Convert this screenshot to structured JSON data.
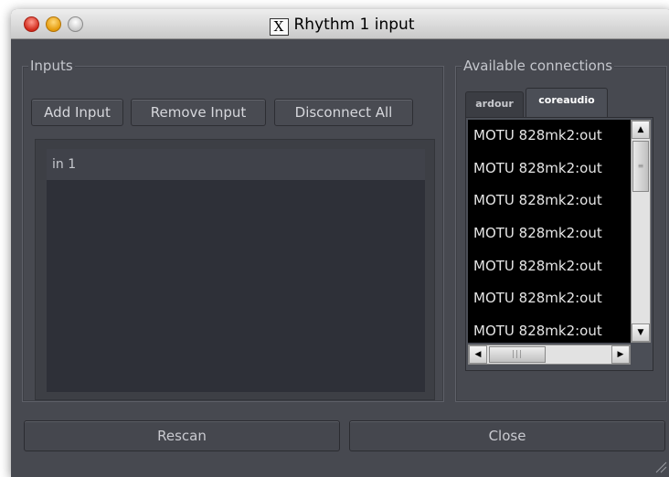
{
  "window": {
    "title": "Rhythm 1 input",
    "title_icon_glyph": "X"
  },
  "inputs": {
    "label": "Inputs",
    "buttons": {
      "add": "Add Input",
      "remove": "Remove Input",
      "disconnect": "Disconnect All"
    },
    "ports": [
      "in 1"
    ]
  },
  "connections": {
    "label": "Available connections",
    "tabs": [
      {
        "label": "ardour",
        "active": false
      },
      {
        "label": "coreaudio",
        "active": true
      }
    ],
    "items": [
      "MOTU 828mk2:out",
      "MOTU 828mk2:out",
      "MOTU 828mk2:out",
      "MOTU 828mk2:out",
      "MOTU 828mk2:out",
      "MOTU 828mk2:out",
      "MOTU 828mk2:out"
    ]
  },
  "footer": {
    "rescan": "Rescan",
    "close": "Close"
  },
  "colors": {
    "window_bg": "#474950",
    "list_bg": "#000000",
    "text": "#c6c8ce"
  }
}
